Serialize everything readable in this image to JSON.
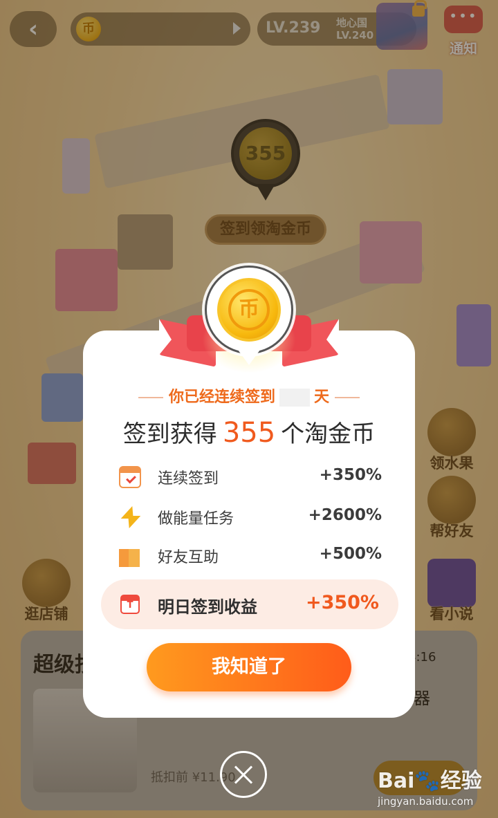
{
  "topbar": {
    "level_current": "LV.239",
    "level_next_name": "地心国",
    "level_next_lv": "LV.240",
    "notify_label": "通知",
    "notify_dots": "•••"
  },
  "map": {
    "marker_value": "355",
    "marker_label": "签到领淘金币"
  },
  "side_buttons": [
    "领水果",
    "帮好友",
    "逛店铺",
    "看小说"
  ],
  "bottom": {
    "title": "超级抄",
    "time": "4:16",
    "item": "器",
    "price": "抵扣前 ¥11.90"
  },
  "modal": {
    "coin_symbol": "币",
    "streak_prefix": "你已经连续签到",
    "streak_suffix": "天",
    "reward_prefix": "签到获得",
    "reward_amount": "355",
    "reward_suffix": "个淘金币",
    "bonuses": [
      {
        "name": "连续签到",
        "value": "+350%",
        "icon": "calendar-check-icon"
      },
      {
        "name": "做能量任务",
        "value": "+2600%",
        "icon": "lightning-icon"
      },
      {
        "name": "好友互助",
        "value": "+500%",
        "icon": "friends-icon"
      }
    ],
    "tomorrow_label": "明日签到收益",
    "tomorrow_value": "+350%",
    "ok_label": "我知道了"
  },
  "watermark": {
    "brand": "Bai🐾经验",
    "site": "jingyan.baidu.com"
  },
  "colors": {
    "accent": "#f05a1e",
    "button_start": "#ff9a1e",
    "button_end": "#ff5c1a",
    "ribbon": "#e8434b"
  }
}
